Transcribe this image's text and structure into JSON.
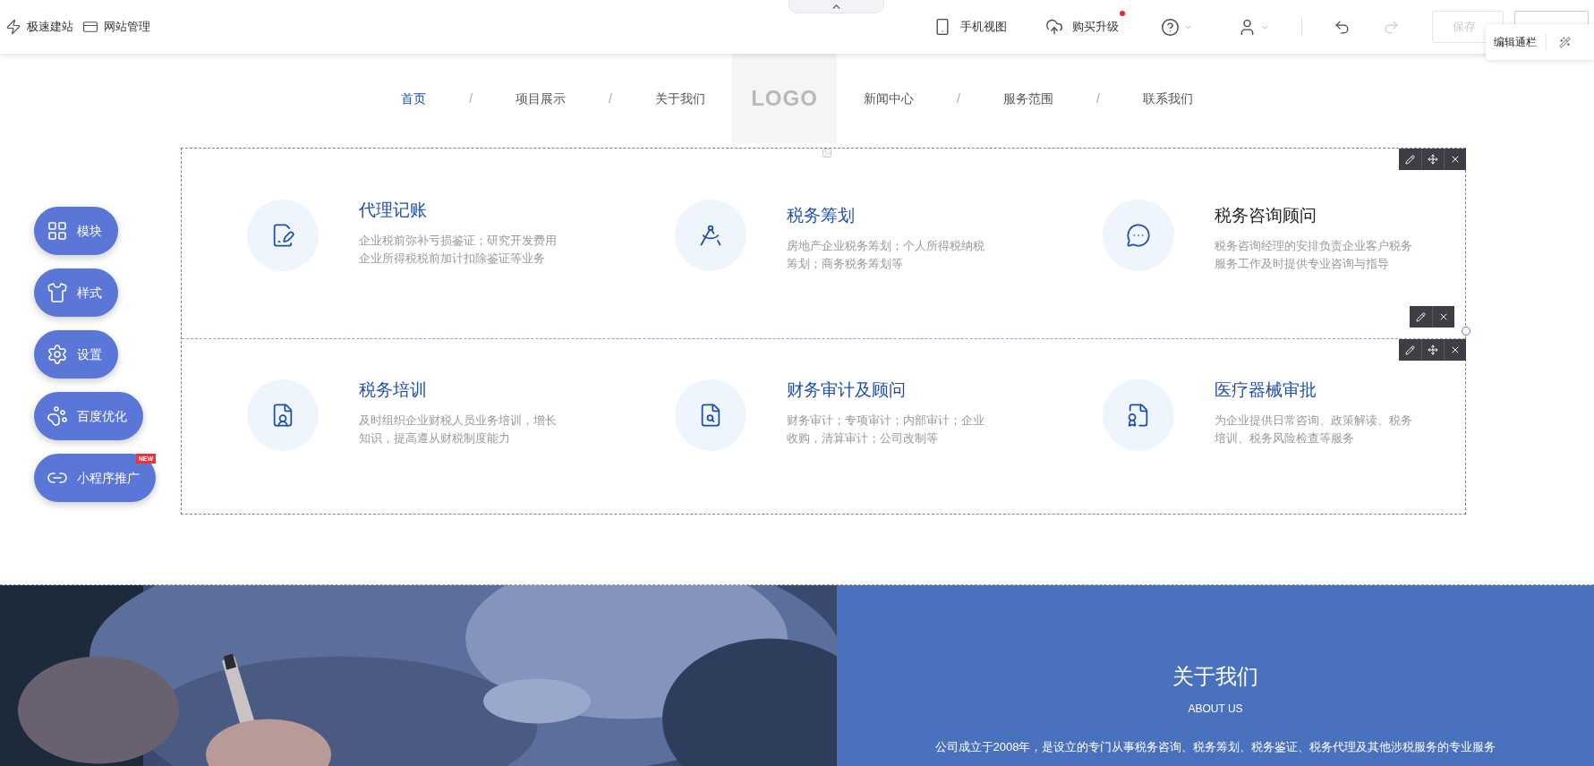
{
  "toolbar": {
    "left": [
      {
        "kind": "bolt",
        "label": "极速建站"
      },
      {
        "kind": "card",
        "label": "网站管理"
      }
    ],
    "right": [
      {
        "kind": "phone",
        "label": "手机视图"
      },
      {
        "kind": "cloud",
        "label": "购买升级",
        "dot": true
      }
    ],
    "undo": {
      "disabled": false
    },
    "redo": {
      "disabled": true
    },
    "save": {
      "label": "保存",
      "disabled": true
    },
    "popup": {
      "label": "编辑通栏"
    }
  },
  "nav": {
    "logo": "LOGO",
    "separators": [
      "/",
      "/",
      "/",
      "/"
    ],
    "items": [
      {
        "label": "首页",
        "selected": true
      },
      {
        "label": "项目展示",
        "selected": false
      },
      {
        "label": "关于我们",
        "selected": false
      },
      {
        "label": "新闻中心",
        "selected": false
      },
      {
        "label": "服务范围",
        "selected": false
      },
      {
        "label": "联系我们",
        "selected": false
      }
    ]
  },
  "services": [
    [
      {
        "title": "代理记账",
        "hovered": false,
        "desc": "企业税前弥补亏损鉴证；研究开发费用企业所得税税前加计扣除鉴证等业务"
      },
      {
        "title": "税务筹划",
        "hovered": false,
        "desc": "房地产企业税务筹划；个人所得税纳税筹划；商务税务筹划等"
      },
      {
        "title": "税务咨询顾问",
        "hovered": true,
        "desc": "税务咨询经理的安排负责企业客户税务服务工作及时提供专业咨询与指导"
      }
    ],
    [
      {
        "title": "税务培训",
        "hovered": false,
        "desc": "及时组织企业财税人员业务培训，增长知识，提高遵从财税制度能力"
      },
      {
        "title": "财务审计及顾问",
        "hovered": false,
        "desc": "财务审计；专项审计；内部审计；企业收购，清算审计；公司改制等"
      },
      {
        "title": "医疗器械审批",
        "hovered": false,
        "desc": "为企业提供日常咨询、政策解读、税务培训、税务风险检查等服务"
      }
    ]
  ],
  "side_buttons": [
    {
      "label": "模块"
    },
    {
      "label": "样式"
    },
    {
      "label": "设置"
    },
    {
      "label": "百度优化"
    },
    {
      "label": "小程序推广",
      "badge": "NEW"
    }
  ],
  "about": {
    "title": "关于我们",
    "subtitle": "ABOUT US",
    "text": "公司成立于2008年，是设立的专门从事税务咨询、税务筹划、税务鉴证、税务代理及其他涉税服务的专业服务"
  }
}
